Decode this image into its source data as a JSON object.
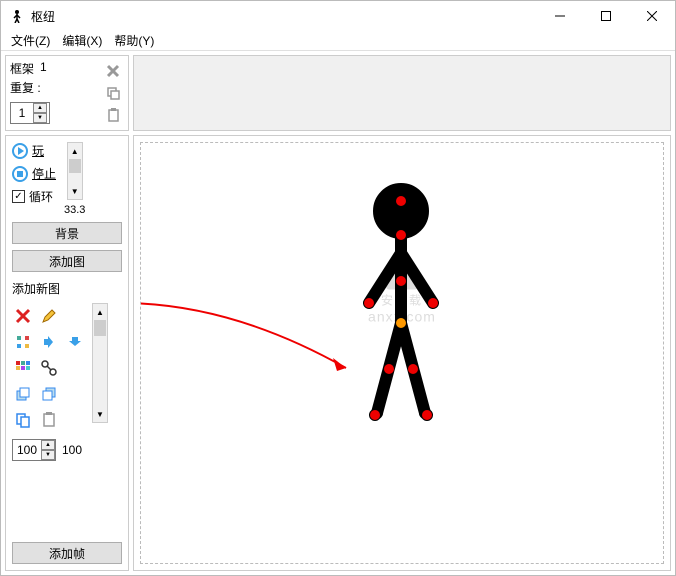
{
  "window": {
    "title": "枢纽"
  },
  "menu": {
    "file": "文件(Z)",
    "edit": "编辑(X)",
    "help": "帮助(Y)"
  },
  "framePanel": {
    "frameLabel": "框架",
    "frameNumber": "1",
    "repeatLabel": "重复 :",
    "repeatValue": "1"
  },
  "playback": {
    "play": "玩",
    "stop": "停止",
    "loop": "循环",
    "loopChecked": "✓",
    "fps": "33.3"
  },
  "buttons": {
    "background": "背景",
    "addFigure": "添加图",
    "addFrame": "添加帧"
  },
  "labels": {
    "addNewFigure": "添加新图"
  },
  "opacity": {
    "value": "100",
    "label": "100"
  },
  "watermark": {
    "main": "安下载",
    "sub": "anxz.com"
  }
}
